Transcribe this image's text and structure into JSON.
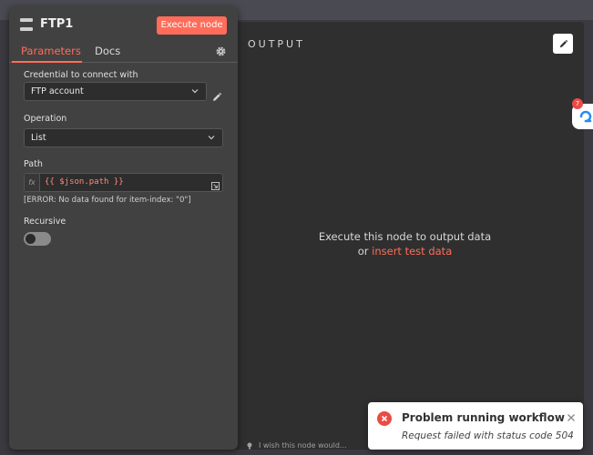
{
  "node": {
    "title": "FTP1",
    "execute_label": "Execute node"
  },
  "tabs": [
    {
      "label": "Parameters",
      "active": true
    },
    {
      "label": "Docs",
      "active": false
    }
  ],
  "fields": {
    "credential": {
      "label": "Credential to connect with",
      "value": "FTP account"
    },
    "operation": {
      "label": "Operation",
      "value": "List"
    },
    "path": {
      "label": "Path",
      "value": "{{ $json.path }}",
      "error": "[ERROR: No data found for item-index: \"0\"]"
    },
    "recursive": {
      "label": "Recursive",
      "enabled": false
    }
  },
  "output": {
    "title": "OUTPUT",
    "message": "Execute this node to output data",
    "or_text": "or ",
    "link": "insert test data"
  },
  "side_badge": {
    "count": "7"
  },
  "hint": {
    "text": "I wish this node would..."
  },
  "toast": {
    "title": "Problem running workflow",
    "message": "Request failed with status code 504"
  },
  "colors": {
    "accent": "#ff6d5a",
    "error": "#ea4b45",
    "panel": "#414141",
    "output_bg": "#2f2f2f"
  },
  "icons": [
    "server-icon",
    "settings-gear-icon",
    "chevron-down-icon",
    "pencil-icon",
    "expand-icon",
    "lightbulb-icon",
    "error-x-icon",
    "close-icon",
    "chat-support-icon"
  ]
}
